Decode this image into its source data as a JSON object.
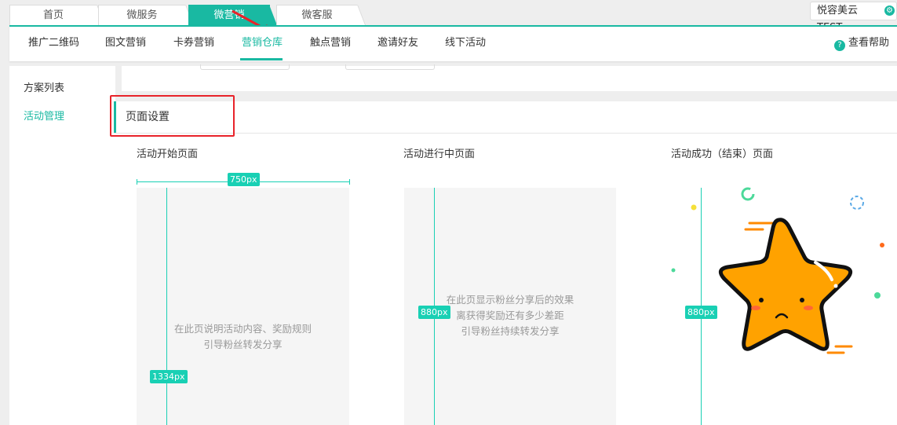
{
  "top_tabs": [
    {
      "label": "首页",
      "active": false
    },
    {
      "label": "微服务",
      "active": false
    },
    {
      "label": "微营销",
      "active": true
    },
    {
      "label": "微客服",
      "active": false
    }
  ],
  "user": {
    "name": "悦容美云TEST",
    "icon": "gear-icon"
  },
  "subnav": {
    "items": [
      {
        "label": "推广二维码",
        "active": false
      },
      {
        "label": "图文营销",
        "active": false
      },
      {
        "label": "卡券营销",
        "active": false
      },
      {
        "label": "营销仓库",
        "active": true
      },
      {
        "label": "触点营销",
        "active": false
      },
      {
        "label": "邀请好友",
        "active": false
      },
      {
        "label": "线下活动",
        "active": false
      }
    ],
    "help_label": "查看帮助",
    "help_icon": "question-icon"
  },
  "sidebar": {
    "items": [
      {
        "label": "方案列表",
        "active": false
      },
      {
        "label": "活动管理",
        "active": true
      }
    ]
  },
  "panel": {
    "title": "页面设置",
    "columns": [
      {
        "title": "活动开始页面",
        "width_label": "750px",
        "height_label": "1334px",
        "text_lines": [
          "在此页说明活动内容、奖励规则",
          "引导粉丝转发分享"
        ]
      },
      {
        "title": "活动进行中页面",
        "height_label": "880px",
        "text_lines": [
          "在此页显示粉丝分享后的效果",
          "离获得奖励还有多少差距",
          "引导粉丝持续转发分享"
        ]
      },
      {
        "title": "活动成功（结束）页面",
        "height_label": "880px",
        "illustration": "sad-star-icon"
      }
    ]
  },
  "colors": {
    "accent": "#19b9a2",
    "guide": "#19d0b4",
    "annotation_red": "#e8232a",
    "star": "#ffa200"
  }
}
